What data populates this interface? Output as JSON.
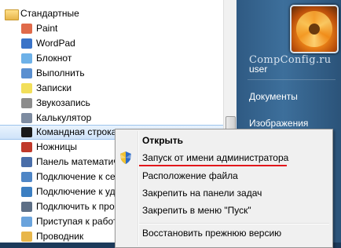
{
  "programs": {
    "folder": "Стандартные",
    "items": [
      {
        "label": "Paint",
        "icon": "paint-icon",
        "color": "#e06a4a"
      },
      {
        "label": "WordPad",
        "icon": "wordpad-icon",
        "color": "#3a73c8"
      },
      {
        "label": "Блокнот",
        "icon": "notepad-icon",
        "color": "#6db1e8"
      },
      {
        "label": "Выполнить",
        "icon": "run-icon",
        "color": "#5a8fd0"
      },
      {
        "label": "Записки",
        "icon": "sticky-notes-icon",
        "color": "#f2df5a"
      },
      {
        "label": "Звукозапись",
        "icon": "microphone-icon",
        "color": "#8c8c8c"
      },
      {
        "label": "Калькулятор",
        "icon": "calculator-icon",
        "color": "#7d8ba0"
      },
      {
        "label": "Командная строка",
        "icon": "command-prompt-icon",
        "color": "#1a1a1a"
      },
      {
        "label": "Ножницы",
        "icon": "scissors-icon",
        "color": "#c0392b"
      },
      {
        "label": "Панель математич",
        "icon": "math-panel-icon",
        "color": "#4a6ea9"
      },
      {
        "label": "Подключение к се",
        "icon": "network-projector-icon",
        "color": "#4f86c6"
      },
      {
        "label": "Подключение к уд",
        "icon": "remote-desktop-icon",
        "color": "#3c7fc2"
      },
      {
        "label": "Подключить к про",
        "icon": "projector-icon",
        "color": "#5d6f86"
      },
      {
        "label": "Приступая к работ",
        "icon": "getting-started-icon",
        "color": "#6aa3dc"
      },
      {
        "label": "Проводник",
        "icon": "explorer-folder-icon",
        "color": "#e8b64a"
      }
    ]
  },
  "right_panel": {
    "watermark": "CompConfig.ru",
    "user": "user",
    "links": [
      "Документы",
      "Изображения"
    ],
    "bottom_partial": "я"
  },
  "context_menu": {
    "items": [
      "Открыть",
      "Запуск от имени администратора",
      "Расположение файла",
      "Закрепить на панели задач",
      "Закрепить в меню \"Пуск\"",
      "Восстановить прежнюю версию"
    ],
    "highlight_color": "#e2161b"
  }
}
